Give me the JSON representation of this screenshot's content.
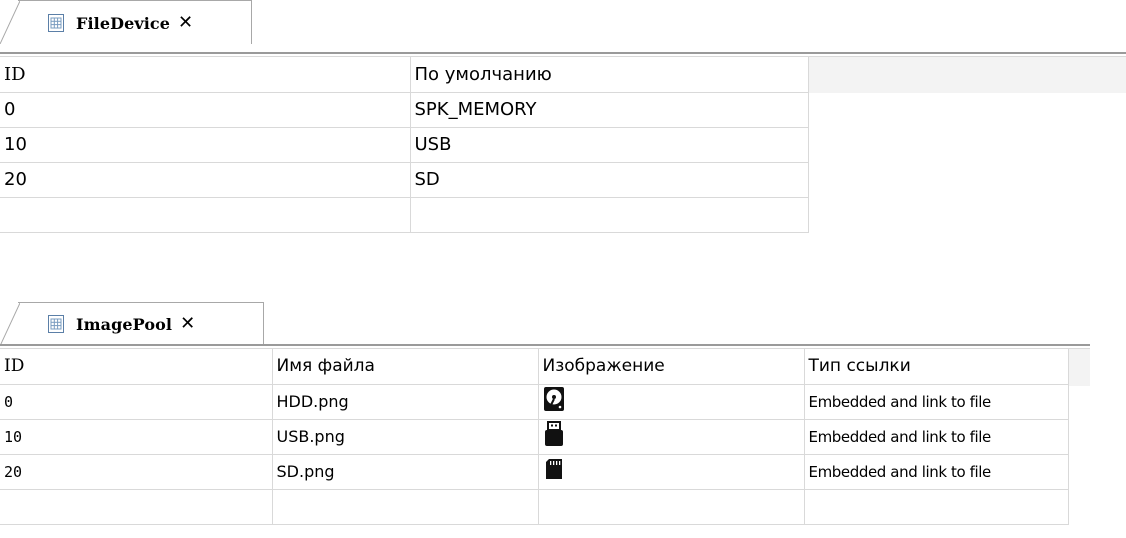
{
  "file_device": {
    "tab_title": "FileDevice",
    "close_glyph": "✕",
    "headers": [
      "ID",
      "По умолчанию"
    ],
    "rows": [
      [
        "0",
        "SPK_MEMORY"
      ],
      [
        "10",
        "USB"
      ],
      [
        "20",
        "SD"
      ],
      [
        "",
        ""
      ]
    ]
  },
  "image_pool": {
    "tab_title": "ImagePool",
    "close_glyph": "✕",
    "headers": [
      "ID",
      "Имя файла",
      "Изображение",
      "Тип ссылки"
    ],
    "rows": [
      {
        "id": "0",
        "file": "HDD.png",
        "image": "hdd-icon",
        "ref": "Embedded and link to file"
      },
      {
        "id": "10",
        "file": "USB.png",
        "image": "usb-drive-icon",
        "ref": "Embedded and link to file"
      },
      {
        "id": "20",
        "file": "SD.png",
        "image": "sd-card-icon",
        "ref": "Embedded and link to file"
      },
      {
        "id": "",
        "file": "",
        "image": "",
        "ref": ""
      }
    ]
  }
}
